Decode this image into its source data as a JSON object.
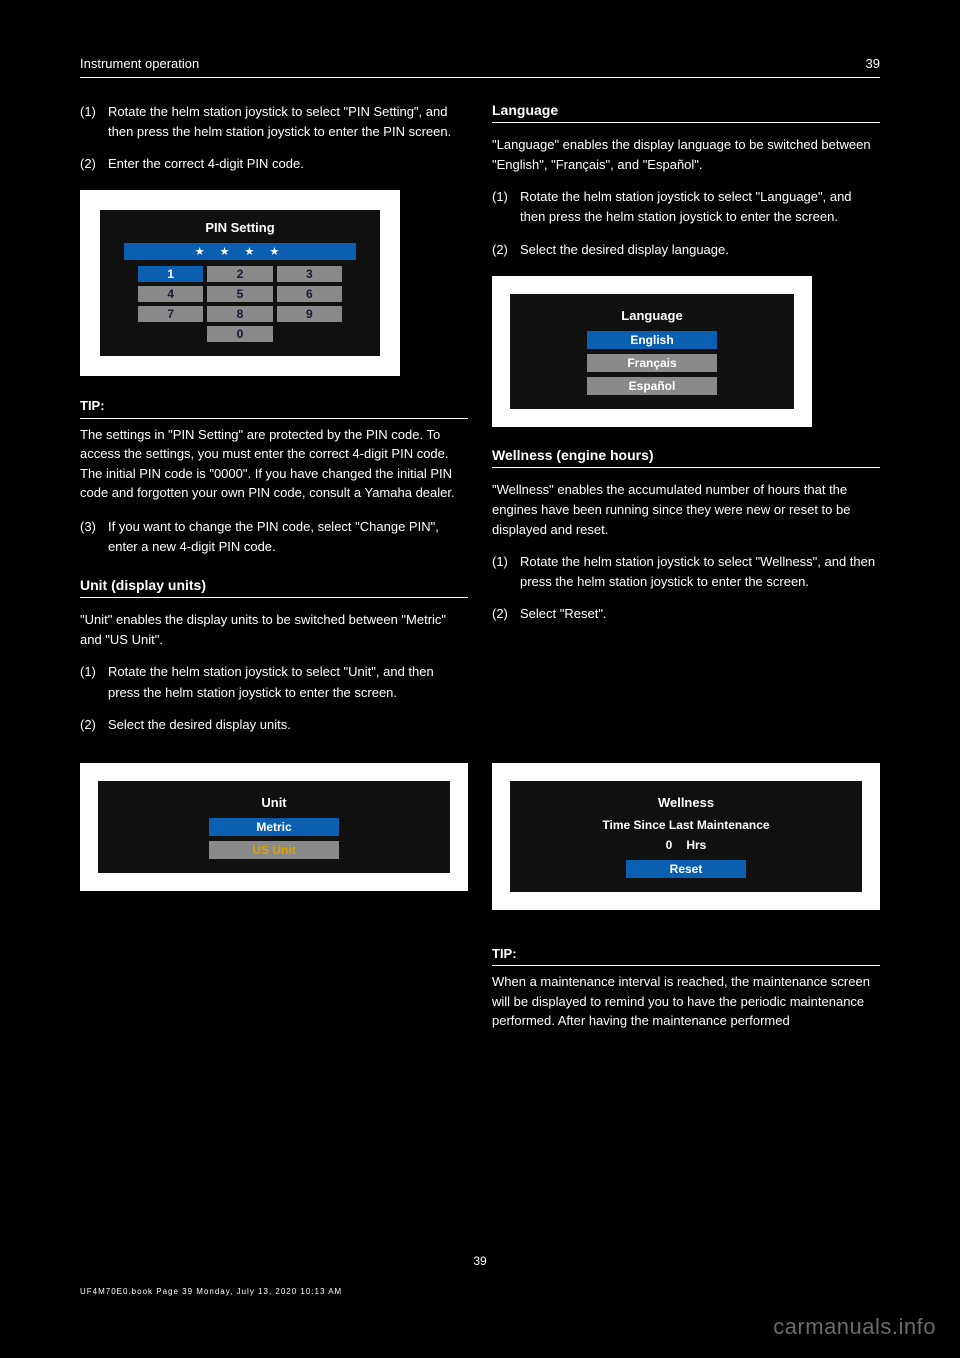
{
  "header": {
    "left": "Instrument operation",
    "right": "39"
  },
  "top_steps": [
    {
      "n": "(1)",
      "t": "Rotate the helm station joystick to select \"PIN Setting\", and then press the helm station joystick to enter the PIN screen."
    },
    {
      "n": "(2)",
      "t": "Enter the correct 4-digit PIN code."
    }
  ],
  "pin": {
    "title": "PIN Setting",
    "display": "★ ★ ★ ★",
    "keys": [
      "1",
      "2",
      "3",
      "4",
      "5",
      "6",
      "7",
      "8",
      "9",
      "0"
    ]
  },
  "tip1_title": "TIP:",
  "tip1_body": "The settings in \"PIN Setting\" are protected by the PIN code. To access the settings, you must enter the correct 4-digit PIN code. The initial PIN code is \"0000\". If you have changed the initial PIN code and forgotten your own PIN code, consult a Yamaha dealer.",
  "left_steps": [
    {
      "n": "(3)",
      "t": "If you want to change the PIN code, select \"Change PIN\", enter a new 4-digit PIN code."
    }
  ],
  "unit_heading": "Unit (display units)",
  "unit_body": "\"Unit\" enables the display units to be switched between \"Metric\" and \"US Unit\".",
  "unit_steps": [
    {
      "n": "(1)",
      "t": "Rotate the helm station joystick to select \"Unit\", and then press the helm station joystick to enter the screen."
    },
    {
      "n": "(2)",
      "t": "Select the desired display units."
    }
  ],
  "unit_screen": {
    "title": "Unit",
    "opts": [
      "Metric",
      "US Unit"
    ],
    "selected": 0,
    "current": 1
  },
  "lang_heading": "Language",
  "lang_body": "\"Language\" enables the display language to be switched between \"English\", \"Français\", and \"Español\".",
  "lang_steps": [
    {
      "n": "(1)",
      "t": "Rotate the helm station joystick to select \"Language\", and then press the helm station joystick to enter the screen."
    },
    {
      "n": "(2)",
      "t": "Select the desired display language."
    }
  ],
  "lang_screen": {
    "title": "Language",
    "opts": [
      "English",
      "Français",
      "Español"
    ],
    "selected": 0
  },
  "wellness_heading": "Wellness (engine hours)",
  "wellness_body": "\"Wellness\" enables the accumulated number of hours that the engines have been running since they were new or reset to be displayed and reset.",
  "wellness_steps": [
    {
      "n": "(1)",
      "t": "Rotate the helm station joystick to select \"Wellness\", and then press the helm station joystick to enter the screen."
    },
    {
      "n": "(2)",
      "t": "Select \"Reset\"."
    }
  ],
  "wellness_screen": {
    "title": "Wellness",
    "subtitle": "Time Since Last Maintenance",
    "value": "0",
    "unit": "Hrs",
    "reset": "Reset"
  },
  "tip2_title": "TIP:",
  "tip2_body": "When a maintenance interval is reached, the maintenance screen will be displayed to remind you to have the periodic maintenance performed. After having the maintenance performed",
  "page_num": "39",
  "footer": "UF4M70E0.book  Page 39  Monday, July 13, 2020  10:13 AM",
  "watermark": "carmanuals.info"
}
